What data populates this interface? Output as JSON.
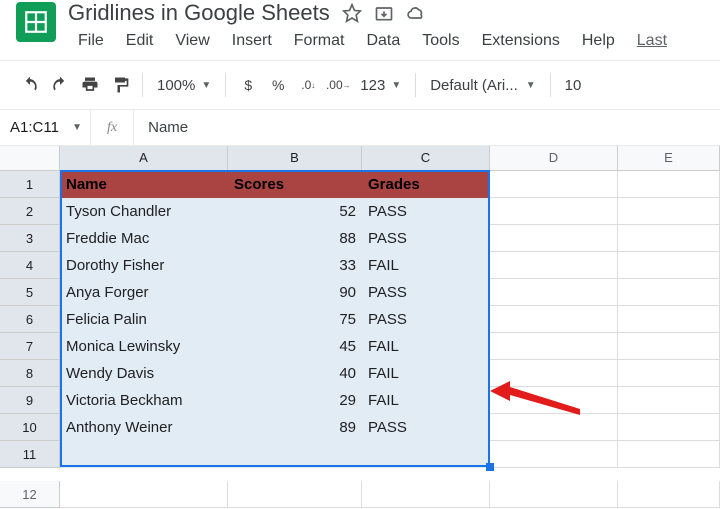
{
  "doc": {
    "title": "Gridlines in Google Sheets"
  },
  "menubar": [
    "File",
    "Edit",
    "View",
    "Insert",
    "Format",
    "Data",
    "Tools",
    "Extensions",
    "Help",
    "Last"
  ],
  "toolbar": {
    "zoom": "100%",
    "currency": "$",
    "percent": "%",
    "dec_dec": ".0",
    "inc_dec": ".00",
    "numfmt": "123",
    "font": "Default (Ari...",
    "fontsize": "10"
  },
  "namebox": "A1:C11",
  "formula": "Name",
  "columns": [
    "A",
    "B",
    "C",
    "D",
    "E"
  ],
  "rows": [
    1,
    2,
    3,
    4,
    5,
    6,
    7,
    8,
    9,
    10,
    11,
    12
  ],
  "chart_data": {
    "type": "table",
    "header": {
      "name": "Name",
      "scores": "Scores",
      "grades": "Grades"
    },
    "data": [
      {
        "name": "Tyson Chandler",
        "score": 52,
        "grade": "PASS"
      },
      {
        "name": "Freddie Mac",
        "score": 88,
        "grade": "PASS"
      },
      {
        "name": "Dorothy Fisher",
        "score": 33,
        "grade": " FAIL"
      },
      {
        "name": "Anya Forger",
        "score": 90,
        "grade": "PASS"
      },
      {
        "name": "Felicia Palin",
        "score": 75,
        "grade": "PASS"
      },
      {
        "name": "Monica Lewinsky",
        "score": 45,
        "grade": "FAIL"
      },
      {
        "name": "Wendy Davis",
        "score": 40,
        "grade": "FAIL"
      },
      {
        "name": "Victoria Beckham",
        "score": 29,
        "grade": "FAIL"
      },
      {
        "name": "Anthony Weiner",
        "score": 89,
        "grade": "PASS"
      }
    ]
  }
}
